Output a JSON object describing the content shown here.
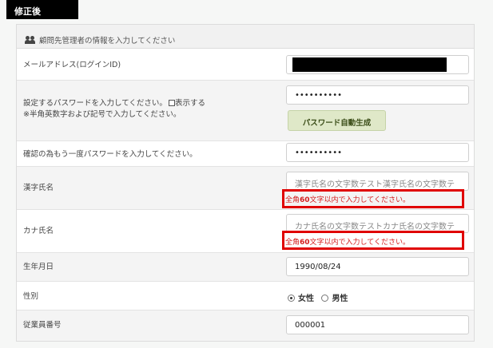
{
  "section_tab": "修正後",
  "panel_header": "顧問先管理者の情報を入力してください",
  "fields": {
    "email_label": "メールアドレス(ログインID)",
    "password_label": "設定するパスワードを入力してください。",
    "password_show_label": "表示する",
    "password_note": "※半角英数字および記号で入力してください。",
    "password_value": "••••••••••",
    "generate_button": "パスワード自動生成",
    "confirm_label": "確認の為もう一度パスワードを入力してください。",
    "confirm_value": "••••••••••",
    "kanji_label": "漢字氏名",
    "kanji_value": "漢字氏名の文字数テスト漢字氏名の文字数テ",
    "kanji_error_prefix": "全角",
    "kanji_error_num": "60",
    "kanji_error_suffix": "文字以内で入力してください。",
    "kana_label": "カナ氏名",
    "kana_value": "カナ氏名の文字数テストカナ氏名の文字数テ",
    "kana_error_prefix": "全角",
    "kana_error_num": "60",
    "kana_error_suffix": "文字以内で入力してください。",
    "birth_label": "生年月日",
    "birth_value": "1990/08/24",
    "gender_label": "性別",
    "gender_female": "女性",
    "gender_male": "男性",
    "employee_label": "従業員番号",
    "employee_value": "000001"
  },
  "colors": {
    "error": "#d41d1d",
    "highlight_box": "#e00000",
    "generate_button_bg": "#dfe8c8"
  }
}
